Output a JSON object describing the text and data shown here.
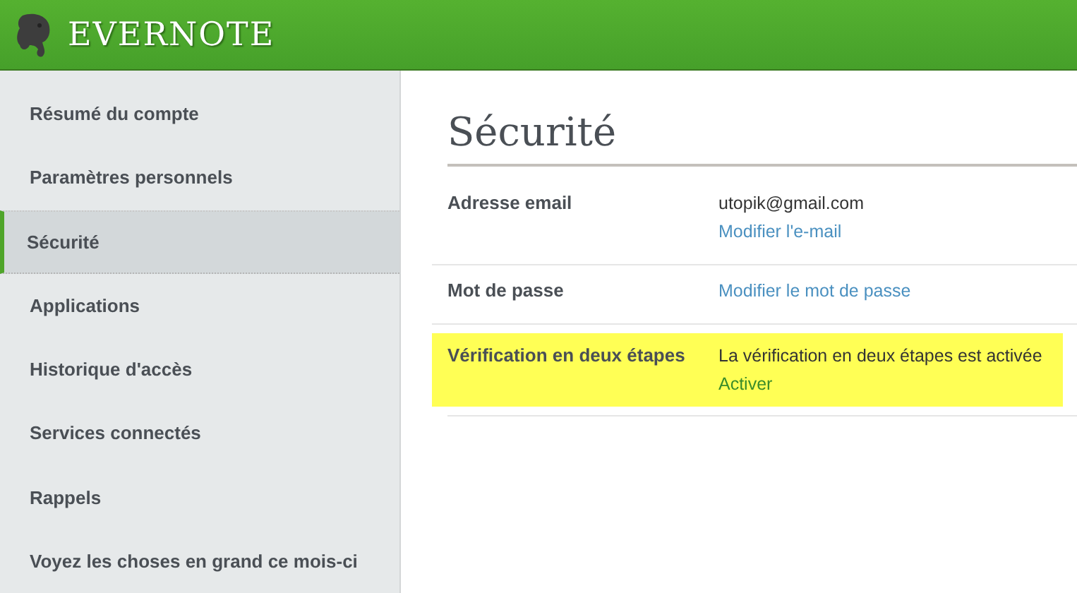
{
  "header": {
    "brand": "EVERNOTE"
  },
  "sidebar": {
    "items": [
      {
        "label": "Résumé du compte",
        "selected": false
      },
      {
        "label": "Paramètres personnels",
        "selected": false
      },
      {
        "label": "Sécurité",
        "selected": true
      },
      {
        "label": "Applications",
        "selected": false
      },
      {
        "label": "Historique d'accès",
        "selected": false
      },
      {
        "label": "Services connectés",
        "selected": false
      },
      {
        "label": "Rappels",
        "selected": false
      },
      {
        "label": "Voyez les choses en grand ce mois-ci",
        "selected": false
      }
    ]
  },
  "main": {
    "title": "Sécurité",
    "rows": [
      {
        "label": "Adresse email",
        "highlighted": false,
        "values": [
          {
            "text": "utopik@gmail.com",
            "kind": "text"
          },
          {
            "text": "Modifier l'e-mail",
            "kind": "link"
          }
        ]
      },
      {
        "label": "Mot de passe",
        "highlighted": false,
        "values": [
          {
            "text": "Modifier le mot de passe",
            "kind": "link"
          }
        ]
      },
      {
        "label": "Vérification en deux étapes",
        "highlighted": true,
        "values": [
          {
            "text": "La vérification en deux étapes est activée",
            "kind": "text"
          },
          {
            "text": "Activer",
            "kind": "action"
          }
        ]
      }
    ]
  }
}
